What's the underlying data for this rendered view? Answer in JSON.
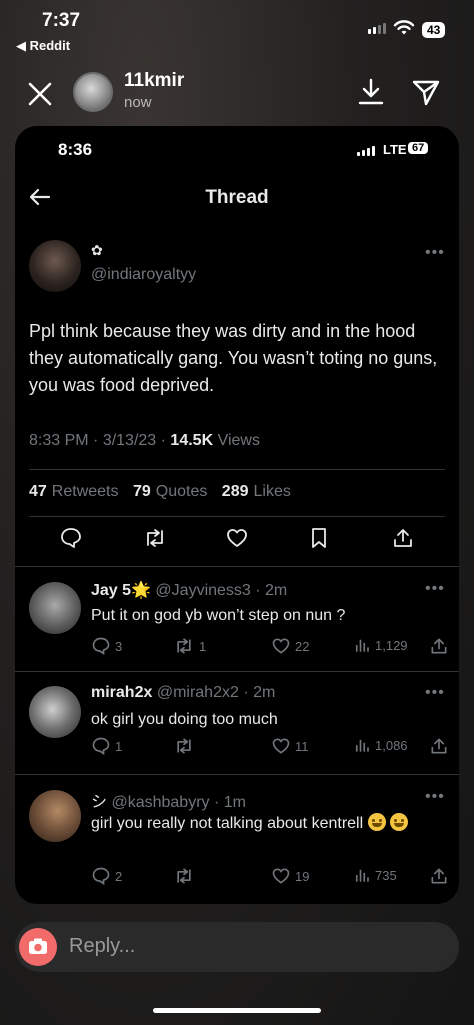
{
  "os_status": {
    "time": "7:37",
    "back_label": "◀ Reddit",
    "battery": "43"
  },
  "story": {
    "username": "11kmir",
    "posted": "now"
  },
  "screenshot": {
    "status": {
      "time": "8:36",
      "network": "LTE",
      "battery": "67"
    },
    "nav_title": "Thread",
    "main_post": {
      "display_name_icon": "✿",
      "handle": "@indiaroyaltyy",
      "text": "Ppl think because they was dirty and in the hood they automatically gang. You wasn’t toting no guns, you was food deprived.",
      "time": "8:33 PM",
      "date": "3/13/23",
      "views": "14.5K",
      "views_label": "Views",
      "retweets": "47",
      "retweets_label": "Retweets",
      "quotes": "79",
      "quotes_label": "Quotes",
      "likes": "289",
      "likes_label": "Likes"
    },
    "replies": [
      {
        "name": "Jay 5",
        "badge": "🌟",
        "handle": "@Jayviness3",
        "time": "2m",
        "text": "Put it on god yb won’t step on nun ?",
        "replies": "3",
        "retweets": "1",
        "likes": "22",
        "views": "1,129"
      },
      {
        "name": "mirah2x",
        "handle": "@mirah2x2",
        "time": "2m",
        "text": "ok girl you doing too much",
        "replies": "1",
        "retweets": "",
        "likes": "11",
        "views": "1,086"
      },
      {
        "name": "シ",
        "handle": "@kashbabyry",
        "time": "1m",
        "text": "girl you really not talking about kentrell",
        "replies": "2",
        "retweets": "",
        "likes": "19",
        "views": "735"
      }
    ]
  },
  "reply_bar": {
    "placeholder": "Reply..."
  },
  "icons": {
    "close": "close-icon",
    "download": "download-icon",
    "send": "send-icon",
    "back": "arrow-left-icon",
    "reply": "comment-icon",
    "retweet": "retweet-icon",
    "like": "heart-icon",
    "bookmark": "bookmark-icon",
    "share": "share-icon",
    "views": "bar-chart-icon",
    "camera": "camera-icon"
  },
  "colors": {
    "card_bg": "#000000",
    "muted": "#71767b",
    "text": "#e7e9ea",
    "camera": "#f26b6b"
  }
}
